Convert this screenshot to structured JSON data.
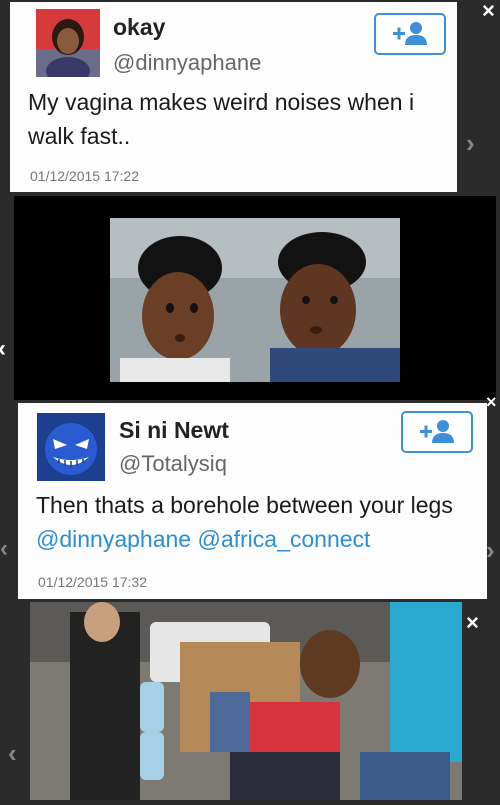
{
  "tweets": [
    {
      "name": "okay",
      "handle": "@dinnyaphane",
      "text": "My vagina makes weird noises when i walk fast..",
      "time": "01/12/2015 17:22",
      "follow_icon": "add-user-icon"
    },
    {
      "name": "Si ni Newt",
      "handle": "@Totalysiq",
      "text_before": "Then thats a borehole between your legs ",
      "mentions": [
        "@dinnyaphane",
        "@africa_connect"
      ],
      "time": "01/12/2015 17:32",
      "follow_icon": "add-user-icon"
    }
  ],
  "overlay_icons": {
    "close": "×",
    "next": "›",
    "prev": "‹"
  },
  "colors": {
    "accent": "#3d8fd8",
    "mention": "#2b8ed8",
    "background": "#2b2b2b"
  }
}
